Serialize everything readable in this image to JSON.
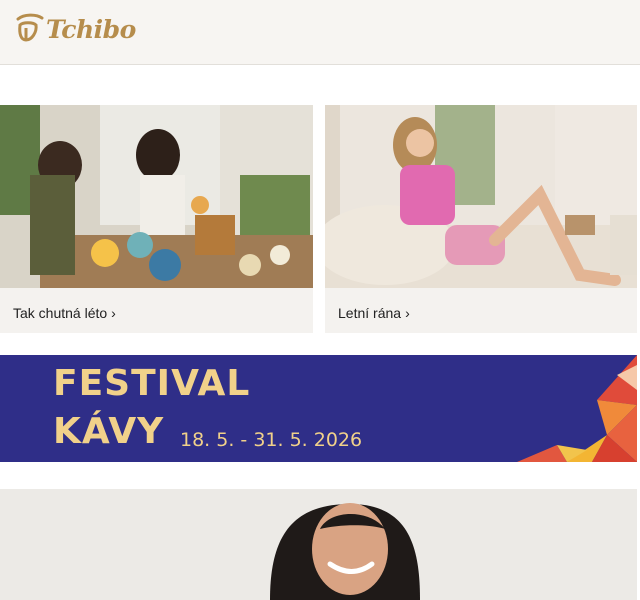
{
  "brand": {
    "name": "Tchibo",
    "color": "#b68d4c"
  },
  "cards": [
    {
      "label": "Tak chutná léto",
      "chevron": "›",
      "image": "friends-summer-dinner-photo"
    },
    {
      "label": "Letní rána",
      "chevron": "›",
      "image": "woman-pink-pajamas-photo"
    }
  ],
  "banner": {
    "line1": "FESTIVAL",
    "line2": "KÁVY",
    "dates": "18. 5. - 31. 5. 2026",
    "bg": "#2f2e88",
    "text_color": "#f1d18a"
  },
  "hero": {
    "image": "smiling-woman-photo"
  }
}
